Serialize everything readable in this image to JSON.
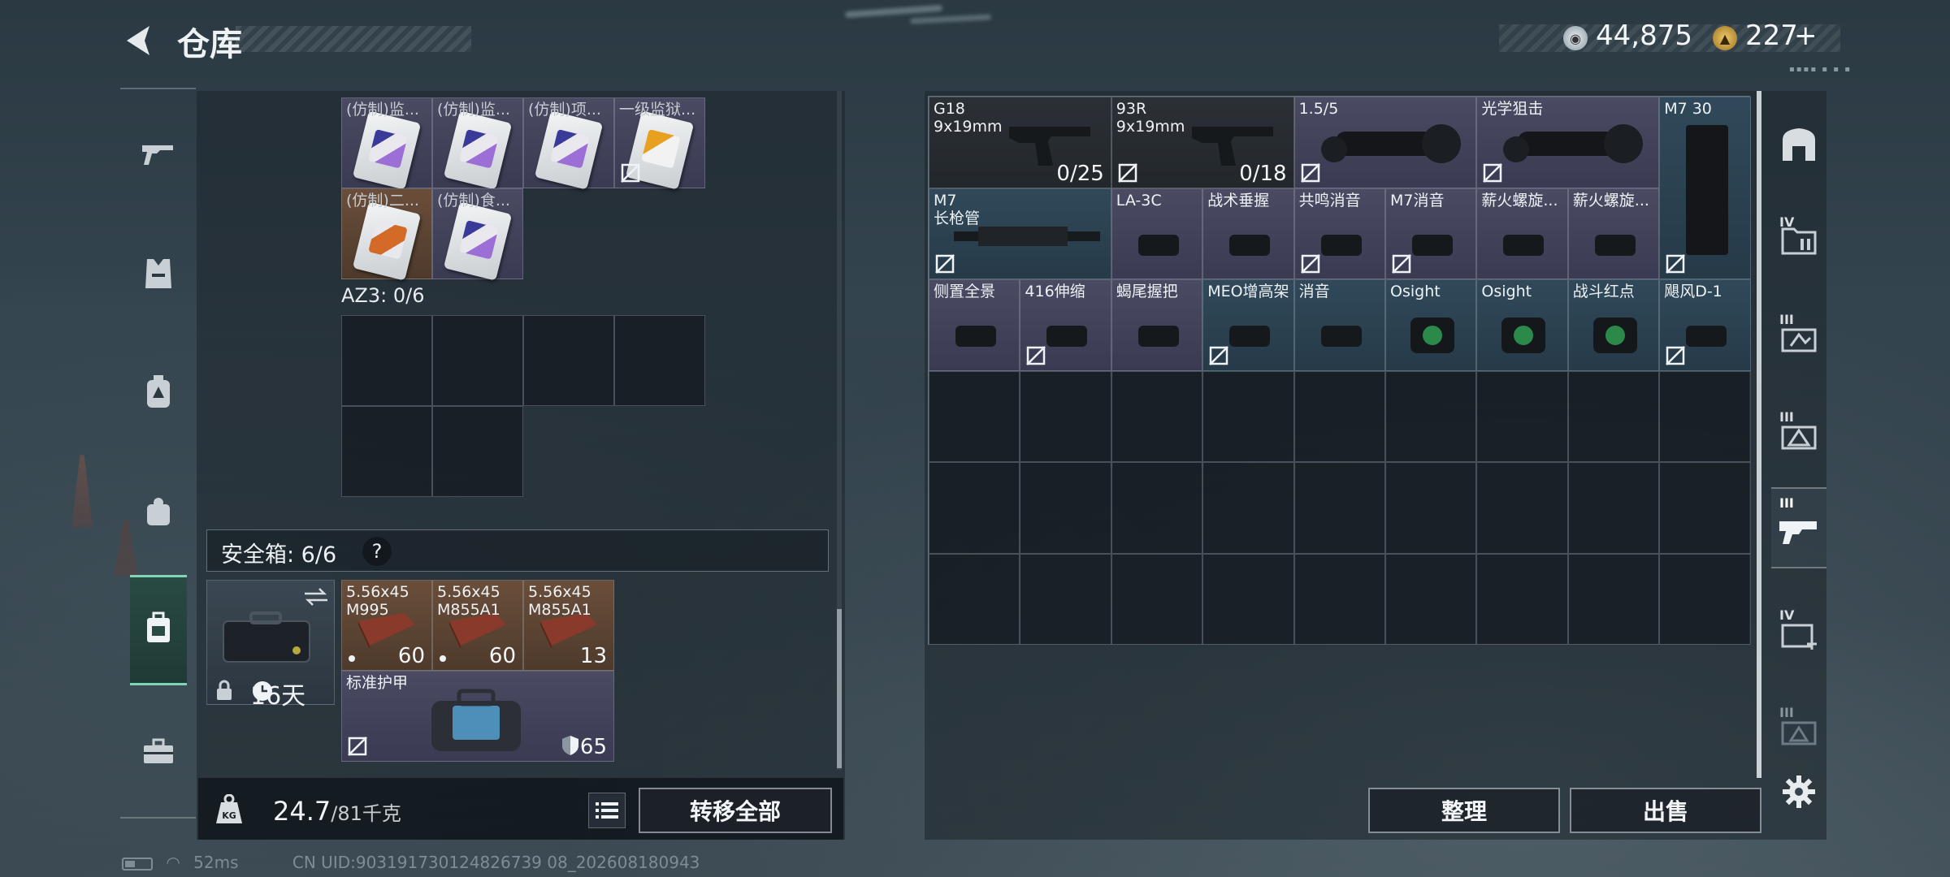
{
  "header": {
    "title": "仓库",
    "currency_silver": "44,875",
    "currency_gold": "227",
    "currency_gold_plus": "+"
  },
  "left_nav": [
    "weapon-icon",
    "armor-vest-icon",
    "backpack-icon",
    "chest-rig-icon",
    "safe-box-icon",
    "toolbox-icon"
  ],
  "left_grid": {
    "items_row1": [
      {
        "label": "(仿制)监...",
        "color": "purple"
      },
      {
        "label": "(仿制)监...",
        "color": "purple"
      },
      {
        "label": "(仿制)项...",
        "color": "purple"
      },
      {
        "label": "一级监狱...",
        "color": "purple",
        "nosell": true
      }
    ],
    "items_row2": [
      {
        "label": "(仿制)二...",
        "color": "brown"
      },
      {
        "label": "(仿制)食...",
        "color": "purple"
      }
    ],
    "az3_label": "AZ3: 0/6"
  },
  "safe": {
    "title": "安全箱: 6/6",
    "help": "?",
    "days": "16天",
    "ammo": [
      {
        "l1": "5.56x45",
        "l2": "M995",
        "count": "60"
      },
      {
        "l1": "5.56x45",
        "l2": "M855A1",
        "count": "60"
      },
      {
        "l1": "5.56x45",
        "l2": "M855A1",
        "count": "13"
      }
    ],
    "armor": {
      "label": "标准护甲",
      "durability": "65"
    }
  },
  "bottom": {
    "weight": "24.7",
    "weight_max": "/81千克",
    "transfer_all": "转移全部"
  },
  "right_items_row1": [
    {
      "l1": "G18",
      "l2": "9x19mm",
      "count": "0/25",
      "color": "dark"
    },
    {
      "l1": "93R",
      "l2": "9x19mm",
      "count": "0/18",
      "color": "dark",
      "nosell": true
    },
    {
      "l1": "1.5/5",
      "l2": "",
      "color": "purple",
      "nosell": true
    },
    {
      "l1": "光学狙击",
      "l2": "",
      "color": "purple",
      "nosell": true
    }
  ],
  "right_items_row2": [
    {
      "l1": "M7",
      "l2": "长枪管",
      "color": "blue",
      "nosell": true
    },
    {
      "l1": "LA-3C",
      "color": "purple"
    },
    {
      "l1": "战术垂握",
      "color": "purple"
    },
    {
      "l1": "共鸣消音",
      "color": "purple",
      "nosell": true
    },
    {
      "l1": "M7消音",
      "color": "purple",
      "nosell": true
    },
    {
      "l1": "薪火螺旋...",
      "color": "purple"
    },
    {
      "l1": "薪火螺旋...",
      "color": "purple"
    }
  ],
  "right_items_row3": [
    {
      "l1": "侧置全景",
      "color": "purple"
    },
    {
      "l1": "416伸缩",
      "color": "purple",
      "nosell": true
    },
    {
      "l1": "蝎尾握把",
      "color": "purple"
    },
    {
      "l1": "MEO增高架",
      "color": "blue",
      "nosell": true
    },
    {
      "l1": "消音",
      "color": "blue"
    },
    {
      "l1": "Osight",
      "color": "blue"
    },
    {
      "l1": "Osight",
      "color": "blue"
    },
    {
      "l1": "战斗红点",
      "color": "blue"
    },
    {
      "l1": "飓风D-1",
      "color": "blue",
      "nosell": true
    }
  ],
  "right_tall": {
    "l1": "M7 30",
    "color": "blue",
    "nosell": true
  },
  "right_buttons": {
    "sort": "整理",
    "sell": "出售"
  },
  "right_nav": [
    {
      "icon": "base-icon",
      "tier": ""
    },
    {
      "icon": "folder-tier-icon",
      "tier": "IV"
    },
    {
      "icon": "gear-tier-icon",
      "tier": "III"
    },
    {
      "icon": "warning-tier-icon",
      "tier": "III"
    },
    {
      "icon": "weapon-tier-icon",
      "tier": "III"
    },
    {
      "icon": "medical-tier-icon",
      "tier": "IV"
    },
    {
      "icon": "locked-tier-icon",
      "tier": "III"
    }
  ],
  "status": {
    "ping": "52ms",
    "uid": "CN UID:903191730124826739 08_202608180943"
  },
  "colors": {
    "accent": "#7fd6b6",
    "item_purple": "#4a4a63",
    "item_blue": "#30495a",
    "item_brown": "#6a4e3a"
  }
}
